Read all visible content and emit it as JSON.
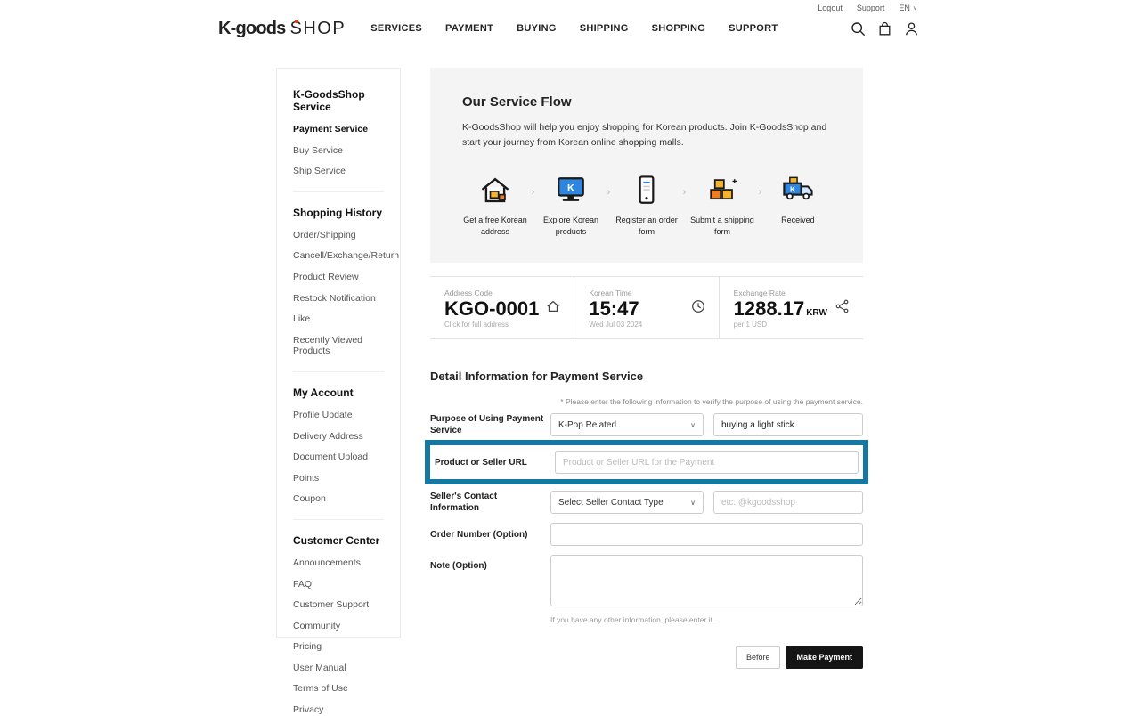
{
  "topbar": {
    "logout": "Logout",
    "support": "Support",
    "lang": "EN"
  },
  "header": {
    "logo_main": "K-goods",
    "logo_sub": "SHOP",
    "nav": [
      "SERVICES",
      "PAYMENT",
      "BUYING",
      "SHIPPING",
      "SHOPPING",
      "SUPPORT"
    ]
  },
  "sidebar": {
    "sections": [
      {
        "title": "K-GoodsShop Service",
        "items": [
          "Payment Service",
          "Buy Service",
          "Ship Service"
        ]
      },
      {
        "title": "Shopping History",
        "items": [
          "Order/Shipping",
          "Cancell/Exchange/Return",
          "Product Review",
          "Restock Notification",
          "Like",
          "Recently Viewed Products"
        ]
      },
      {
        "title": "My Account",
        "items": [
          "Profile Update",
          "Delivery Address",
          "Document Upload",
          "Points",
          "Coupon"
        ]
      },
      {
        "title": "Customer Center",
        "items": [
          "Announcements",
          "FAQ",
          "Customer Support",
          "Community",
          "Pricing",
          "User Manual",
          "Terms of Use",
          "Privacy"
        ]
      }
    ]
  },
  "flow": {
    "title": "Our Service Flow",
    "desc": "K-GoodsShop will help you enjoy shopping for Korean products. Join K-GoodsShop and start your journey from Korean online shopping malls.",
    "steps": [
      {
        "label": "Get a free Korean address",
        "icon": "korean-address-icon"
      },
      {
        "label": "Explore Korean products",
        "icon": "explore-products-icon"
      },
      {
        "label": "Register an order form",
        "icon": "order-form-icon"
      },
      {
        "label": "Submit a shipping form",
        "icon": "shipping-form-icon"
      },
      {
        "label": "Received",
        "icon": "received-truck-icon"
      }
    ]
  },
  "info": {
    "cards": [
      {
        "label": "Address Code",
        "value": "KGO-0001",
        "sub": "Click for full address",
        "icon": "home-icon"
      },
      {
        "label": "Korean Time",
        "value": "15:47",
        "sub": "Wed Jul 03 2024",
        "icon": "clock-icon"
      },
      {
        "label": "Exchange Rate",
        "value": "1288.17",
        "unit": "KRW",
        "sub": "per 1 USD",
        "icon": "exchange-icon"
      }
    ]
  },
  "form": {
    "title": "Detail Information for Payment Service",
    "note": "* Please enter the following information to verify the purpose of using the payment service.",
    "purpose": {
      "label": "Purpose of Using Payment Service",
      "select": "K-Pop Related",
      "value": "buying a light stick"
    },
    "url": {
      "label": "Product or Seller URL",
      "placeholder": "Product or Seller URL for the Payment"
    },
    "contact": {
      "label": "Seller's Contact Information",
      "select": "Select Seller Contact Type",
      "placeholder": "etc: @kgoodsshop"
    },
    "order": {
      "label": "Order Number (Option)"
    },
    "memo": {
      "label": "Note (Option)"
    },
    "helper": "If you have any other information, please enter it.",
    "before": "Before",
    "submit": "Make Payment"
  },
  "colors": {
    "highlight": "#1578a2",
    "accent_red": "#e8380d",
    "brand_blue": "#2e86de",
    "brand_orange": "#f7b32b",
    "submit_bg": "#151515"
  }
}
